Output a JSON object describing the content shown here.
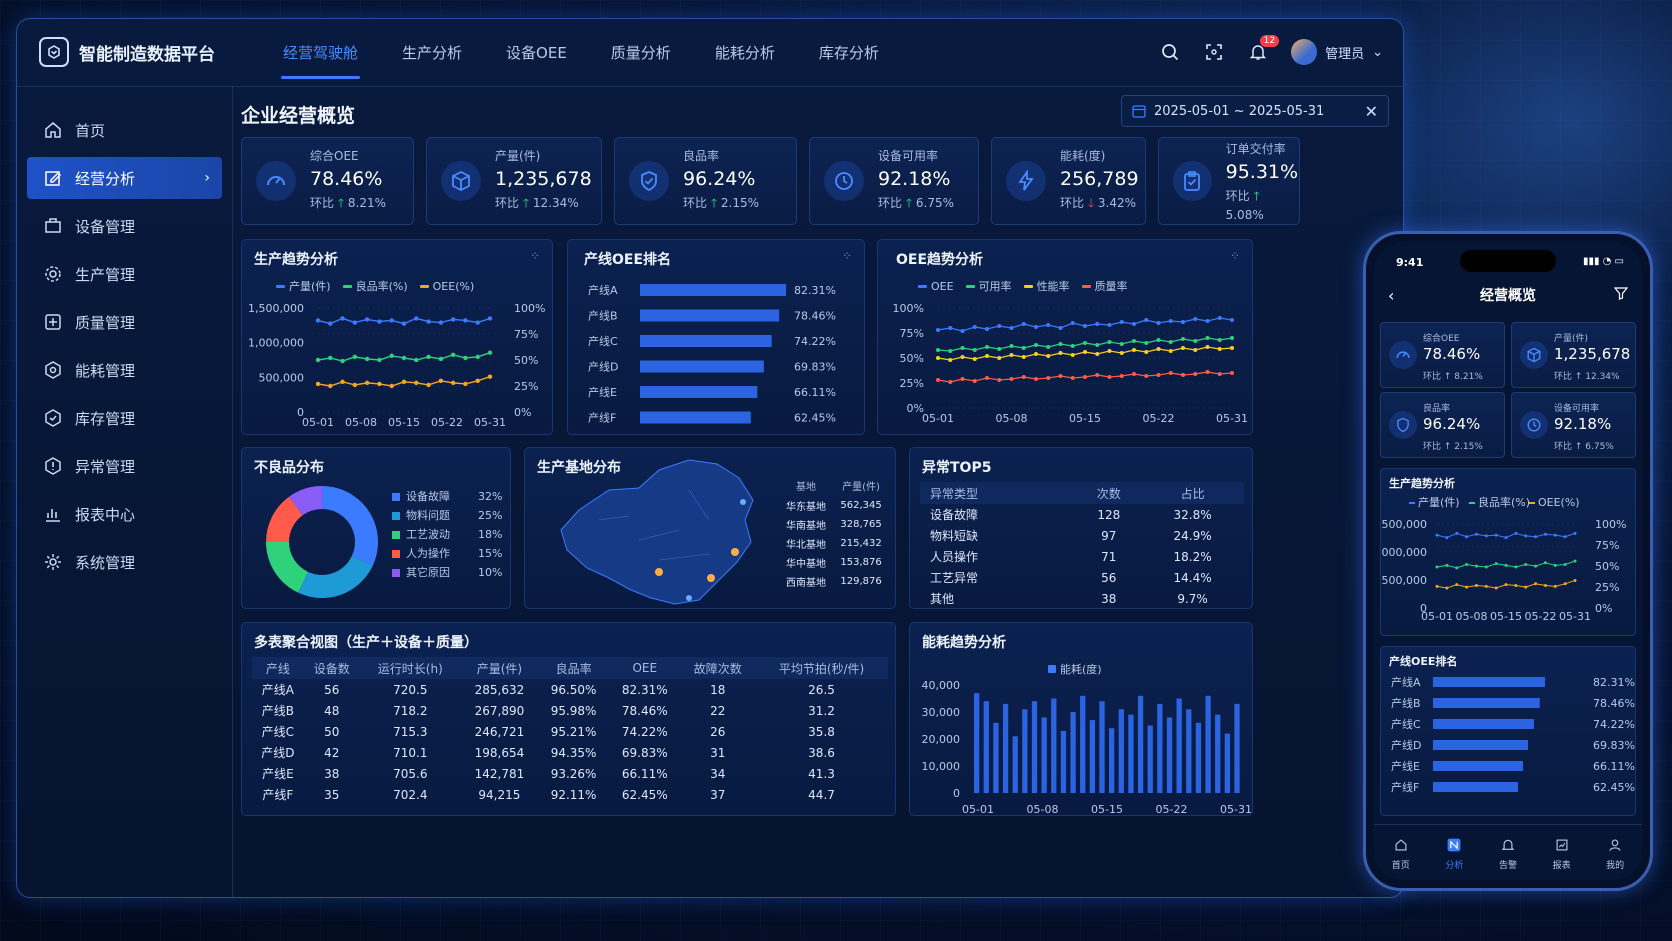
{
  "app": {
    "title": "智能制造数据平台",
    "tabs": [
      {
        "label": "经营驾驶舱",
        "active": true
      },
      {
        "label": "生产分析",
        "active": false
      },
      {
        "label": "设备OEE",
        "active": false
      },
      {
        "label": "质量分析",
        "active": false
      },
      {
        "label": "能耗分析",
        "active": false
      },
      {
        "label": "库存分析",
        "active": false
      }
    ],
    "notification_count": "12",
    "user": "管理员"
  },
  "sidebar": {
    "items": [
      {
        "label": "首页",
        "icon": "home-icon",
        "active": false
      },
      {
        "label": "经营分析",
        "icon": "edit-chart-icon",
        "active": true
      },
      {
        "label": "设备管理",
        "icon": "device-icon",
        "active": false
      },
      {
        "label": "生产管理",
        "icon": "gear-icon",
        "active": false
      },
      {
        "label": "质量管理",
        "icon": "quality-icon",
        "active": false
      },
      {
        "label": "能耗管理",
        "icon": "energy-icon",
        "active": false
      },
      {
        "label": "库存管理",
        "icon": "inventory-icon",
        "active": false
      },
      {
        "label": "异常管理",
        "icon": "alert-icon",
        "active": false
      },
      {
        "label": "报表中心",
        "icon": "report-icon",
        "active": false
      },
      {
        "label": "系统管理",
        "icon": "settings-icon",
        "active": false
      }
    ]
  },
  "page": {
    "title": "企业经营概览",
    "date_range": "2025-05-01 ~ 2025-05-31"
  },
  "kpis": [
    {
      "label": "综合OEE",
      "value": "78.46%",
      "change_label": "环比",
      "change": "8.21%",
      "dir": "up",
      "icon": "gauge-icon"
    },
    {
      "label": "产量(件)",
      "value": "1,235,678",
      "change_label": "环比",
      "change": "12.34%",
      "dir": "up",
      "icon": "cube-icon"
    },
    {
      "label": "良品率",
      "value": "96.24%",
      "change_label": "环比",
      "change": "2.15%",
      "dir": "up",
      "icon": "shield-check-icon"
    },
    {
      "label": "设备可用率",
      "value": "92.18%",
      "change_label": "环比",
      "change": "6.75%",
      "dir": "up",
      "icon": "clock-icon"
    },
    {
      "label": "能耗(度)",
      "value": "256,789",
      "change_label": "环比",
      "change": "3.42%",
      "dir": "down",
      "icon": "lightning-icon"
    },
    {
      "label": "订单交付率",
      "value": "95.31%",
      "change_label": "环比",
      "change": "5.08%",
      "dir": "up",
      "icon": "clipboard-check-icon"
    }
  ],
  "colors": {
    "blue": "#3b7bff",
    "green": "#2fd27a",
    "orange": "#f5a623",
    "red": "#ff5a4a",
    "purple": "#8a5cf6",
    "accent": "#1f52c8"
  },
  "chart_data": [
    {
      "type": "line",
      "title": "生产趋势分析",
      "x_ticks": [
        "05-01",
        "05-08",
        "05-15",
        "05-22",
        "05-31"
      ],
      "y_left_ticks": [
        "1,500,000",
        "1,000,000",
        "500,000",
        "0"
      ],
      "y_right_ticks": [
        "100%",
        "75%",
        "50%",
        "25%",
        "0%"
      ],
      "ylim_right": [
        0,
        100
      ],
      "series": [
        {
          "name": "产量(件)",
          "color": "#3b7bff",
          "values": [
            88,
            85,
            90,
            86,
            89,
            87,
            88,
            85,
            90,
            87,
            86,
            89,
            88,
            86,
            90
          ]
        },
        {
          "name": "良品率(%)",
          "color": "#2fd27a",
          "values": [
            50,
            52,
            49,
            53,
            51,
            50,
            54,
            52,
            50,
            53,
            51,
            55,
            52,
            53,
            57
          ]
        },
        {
          "name": "OEE(%)",
          "color": "#f5a623",
          "values": [
            27,
            25,
            29,
            26,
            28,
            27,
            25,
            29,
            28,
            26,
            30,
            28,
            27,
            30,
            34
          ]
        }
      ]
    },
    {
      "type": "bar",
      "title": "产线OEE排名",
      "categories": [
        "产线A",
        "产线B",
        "产线C",
        "产线D",
        "产线E",
        "产线F"
      ],
      "values": [
        82.31,
        78.46,
        74.22,
        69.83,
        66.11,
        62.45
      ],
      "labels": [
        "82.31%",
        "78.46%",
        "74.22%",
        "69.83%",
        "66.11%",
        "62.45%"
      ]
    },
    {
      "type": "line",
      "title": "OEE趋势分析",
      "x_ticks": [
        "05-01",
        "05-08",
        "05-15",
        "05-22",
        "05-31"
      ],
      "y_ticks": [
        "100%",
        "75%",
        "50%",
        "25%",
        "0%"
      ],
      "ylim": [
        0,
        100
      ],
      "series": [
        {
          "name": "OEE",
          "color": "#3b7bff",
          "values": [
            78,
            80,
            77,
            81,
            79,
            82,
            80,
            84,
            81,
            83,
            80,
            85,
            82,
            84,
            83,
            86,
            84,
            88,
            85,
            87,
            86,
            89,
            87,
            90,
            88
          ]
        },
        {
          "name": "可用率",
          "color": "#2fd27a",
          "values": [
            58,
            57,
            60,
            58,
            61,
            59,
            62,
            60,
            63,
            61,
            64,
            62,
            65,
            63,
            66,
            64,
            67,
            65,
            68,
            66,
            69,
            67,
            70,
            68,
            70
          ]
        },
        {
          "name": "性能率",
          "color": "#f5d020",
          "values": [
            50,
            48,
            51,
            49,
            52,
            50,
            53,
            51,
            54,
            52,
            55,
            53,
            56,
            54,
            57,
            55,
            58,
            56,
            59,
            57,
            60,
            58,
            61,
            59,
            60
          ]
        },
        {
          "name": "质量率",
          "color": "#ff5a4a",
          "values": [
            28,
            26,
            29,
            27,
            30,
            28,
            29,
            31,
            29,
            30,
            32,
            30,
            31,
            33,
            31,
            32,
            34,
            32,
            33,
            35,
            33,
            34,
            36,
            34,
            35
          ]
        }
      ]
    },
    {
      "type": "pie",
      "title": "不良品分布",
      "labels": [
        "设备故障",
        "物料问题",
        "工艺波动",
        "人为操作",
        "其它原因"
      ],
      "values": [
        32,
        25,
        18,
        15,
        10
      ],
      "value_labels": [
        "32%",
        "25%",
        "18%",
        "15%",
        "10%"
      ],
      "colors": [
        "#3b7bff",
        "#1e9bd7",
        "#2fd27a",
        "#ff5a4a",
        "#8a5cf6"
      ]
    },
    {
      "type": "bar",
      "title": "能耗趋势分析",
      "legend": "能耗(度)",
      "x_ticks": [
        "05-01",
        "05-08",
        "05-15",
        "05-22",
        "05-31"
      ],
      "y_ticks": [
        "40,000",
        "30,000",
        "20,000",
        "10,000",
        "0"
      ],
      "ylim": [
        0,
        40000
      ],
      "values": [
        37000,
        34000,
        26000,
        33000,
        21000,
        31000,
        34000,
        28000,
        35000,
        23000,
        30000,
        36000,
        27000,
        34000,
        24000,
        31000,
        29000,
        36000,
        25000,
        33000,
        28000,
        35000,
        31000,
        26000,
        36000,
        29000,
        22000,
        33000
      ]
    }
  ],
  "defect_panel": {
    "title": "不良品分布"
  },
  "base_panel": {
    "title": "生产基地分布",
    "headers": [
      "基地",
      "产量(件)"
    ],
    "rows": [
      [
        "华东基地",
        "562,345"
      ],
      [
        "华南基地",
        "328,765"
      ],
      [
        "华北基地",
        "215,432"
      ],
      [
        "华中基地",
        "153,876"
      ],
      [
        "西南基地",
        "129,876"
      ]
    ]
  },
  "anomaly_panel": {
    "title": "异常TOP5",
    "headers": [
      "异常类型",
      "次数",
      "占比"
    ],
    "rows": [
      [
        "设备故障",
        "128",
        "32.8%"
      ],
      [
        "物料短缺",
        "97",
        "24.9%"
      ],
      [
        "人员操作",
        "71",
        "18.2%"
      ],
      [
        "工艺异常",
        "56",
        "14.4%"
      ],
      [
        "其他",
        "38",
        "9.7%"
      ]
    ]
  },
  "multi_table": {
    "title": "多表聚合视图（生产＋设备＋质量）",
    "headers": [
      "产线",
      "设备数",
      "运行时长(h)",
      "产量(件)",
      "良品率",
      "OEE",
      "故障次数",
      "平均节拍(秒/件)"
    ],
    "rows": [
      [
        "产线A",
        "56",
        "720.5",
        "285,632",
        "96.50%",
        "82.31%",
        "18",
        "26.5"
      ],
      [
        "产线B",
        "48",
        "718.2",
        "267,890",
        "95.98%",
        "78.46%",
        "22",
        "31.2"
      ],
      [
        "产线C",
        "50",
        "715.3",
        "246,721",
        "95.21%",
        "74.22%",
        "26",
        "35.8"
      ],
      [
        "产线D",
        "42",
        "710.1",
        "198,654",
        "94.35%",
        "69.83%",
        "31",
        "38.6"
      ],
      [
        "产线E",
        "38",
        "705.6",
        "142,781",
        "93.26%",
        "66.11%",
        "34",
        "41.3"
      ],
      [
        "产线F",
        "35",
        "702.4",
        "94,215",
        "92.11%",
        "62.45%",
        "37",
        "44.7"
      ]
    ]
  },
  "phone": {
    "time": "9:41",
    "title": "企业经营概览",
    "header": "经营概览",
    "kpis": [
      {
        "label": "综合OEE",
        "value": "78.46%",
        "change": "环比 ↑ 8.21%"
      },
      {
        "label": "产量(件)",
        "value": "1,235,678",
        "change": "环比 ↑ 12.34%"
      },
      {
        "label": "良品率",
        "value": "96.24%",
        "change": "环比 ↑ 2.15%"
      },
      {
        "label": "设备可用率",
        "value": "92.18%",
        "change": "环比 ↑ 6.75%"
      }
    ],
    "trend_title": "生产趋势分析",
    "oee_title": "产线OEE排名",
    "tabs": [
      {
        "label": "首页",
        "active": false
      },
      {
        "label": "分析",
        "active": true
      },
      {
        "label": "告警",
        "active": false
      },
      {
        "label": "报表",
        "active": false
      },
      {
        "label": "我的",
        "active": false
      }
    ]
  }
}
